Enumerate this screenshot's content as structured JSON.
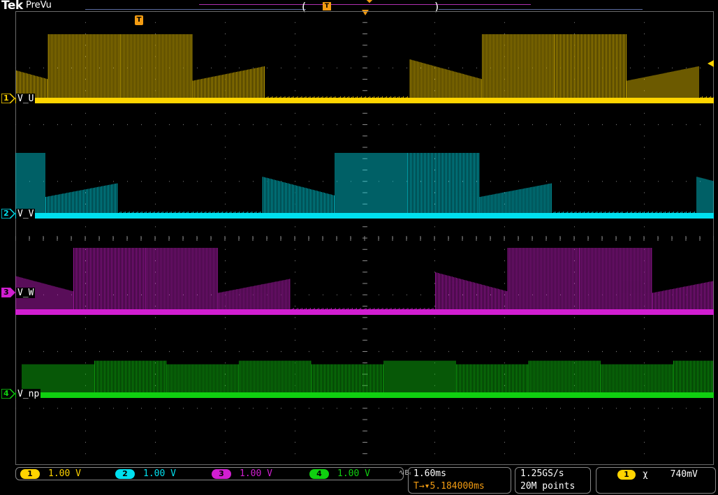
{
  "header": {
    "brand": "Tek",
    "status": "PreVu",
    "trigger_pos_icon": "T",
    "trigger_icon": "T"
  },
  "icons": {
    "trigger_position": "trigger-position-icon",
    "trigger_point": "trigger-point-arrow-icon",
    "bandwidth_limit": "bandwidth-limit-icon",
    "trigger_level": "trigger-level-arrow-icon"
  },
  "channels": [
    {
      "num": "1",
      "label": "V_U",
      "color": "#ffd400",
      "scale": "1.00 V"
    },
    {
      "num": "2",
      "label": "V_V",
      "color": "#00e0ef",
      "scale": "1.00 V"
    },
    {
      "num": "3",
      "label": "V_W",
      "color": "#d11ed1",
      "scale": "1.00 V"
    },
    {
      "num": "4",
      "label": "V_np",
      "color": "#10d010",
      "scale": "1.00 V"
    }
  ],
  "horizontal": {
    "time_per_div": "1.60ms",
    "trigger_arrow": "T→",
    "trigger_delay": "▾5.184000ms"
  },
  "acquisition": {
    "sample_rate": "1.25GS/s",
    "record_length": "20M points"
  },
  "trigger": {
    "source": "1",
    "slope": "χ",
    "level": "740mV"
  },
  "bw_icon": "∿Bₗ"
}
